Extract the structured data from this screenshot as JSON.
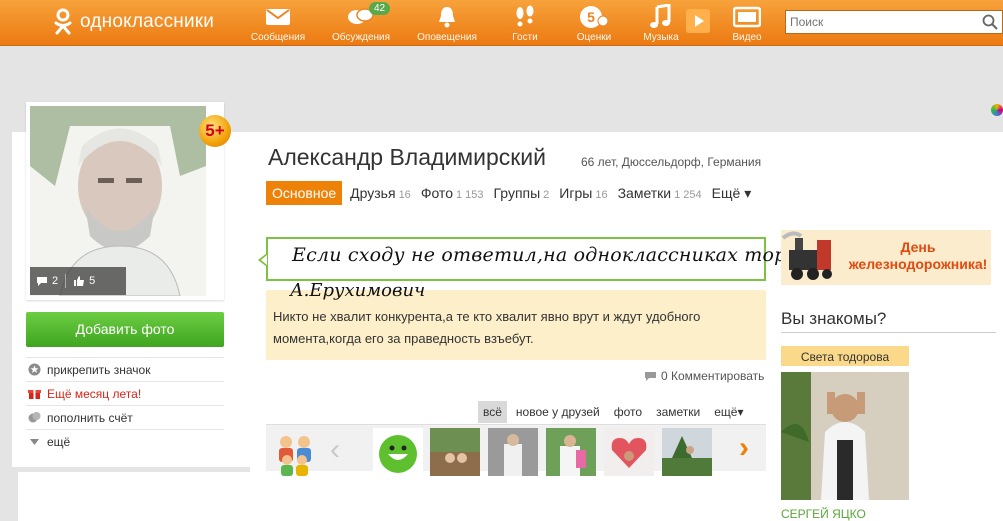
{
  "header": {
    "logo_text": "одноклассники",
    "nav": [
      {
        "label": "Сообщения",
        "icon": "envelope-icon"
      },
      {
        "label": "Обсуждения",
        "icon": "chat-bubbles-icon",
        "badge": "42"
      },
      {
        "label": "Оповещения",
        "icon": "bell-icon"
      },
      {
        "label": "Гости",
        "icon": "footprints-icon"
      },
      {
        "label": "Оценки",
        "icon": "rating-five-icon"
      },
      {
        "label": "Музыка",
        "icon": "music-note-icon"
      },
      {
        "label": "Видео",
        "icon": "video-icon"
      }
    ],
    "search_placeholder": "Поиск"
  },
  "profile": {
    "name": "Александр Владимирский",
    "meta": "66 лет, Дюссельдорф, Германия",
    "badge": "5+",
    "avatar_comments": "2",
    "avatar_likes": "5",
    "add_photo": "Добавить фото",
    "side_menu": [
      {
        "label": "прикрепить значок",
        "icon": "star-badge-icon"
      },
      {
        "label": "Ещё месяц лета!",
        "icon": "gift-icon"
      },
      {
        "label": "пополнить счёт",
        "icon": "coins-icon"
      },
      {
        "label": "ещё",
        "icon": "triangle-down-icon"
      }
    ],
    "tabs": [
      {
        "label": "Основное",
        "count": ""
      },
      {
        "label": "Друзья",
        "count": "16"
      },
      {
        "label": "Фото",
        "count": "1 153"
      },
      {
        "label": "Группы",
        "count": "2"
      },
      {
        "label": "Игры",
        "count": "16"
      },
      {
        "label": "Заметки",
        "count": "1 254"
      },
      {
        "label": "Ещё ▾",
        "count": ""
      }
    ]
  },
  "status": {
    "handwritten_line1": "Если сходу не ответил,на одноклассниках торчу.",
    "handwritten_line2": "А.Ерухимович",
    "note": "Никто не хвалит конкурента,а те кто хвалит явно врут и ждут удобного момента,когда его за праведность взъебут.",
    "comment": "0 Комментировать"
  },
  "feed_filter": [
    "всё",
    "новое у друзей",
    "фото",
    "заметки",
    "ещё▾"
  ],
  "right": {
    "ad_text": "День железнодорожника!",
    "know_title": "Вы знакомы?",
    "friend_caption": "Света тодорова",
    "friend_name": "СЕРГЕЙ ЯЦКО"
  },
  "colors": {
    "brand_orange": "#ee8208",
    "green_button": "#4cb52a",
    "status_border": "#7cc243",
    "note_bg": "#fdefc9"
  }
}
